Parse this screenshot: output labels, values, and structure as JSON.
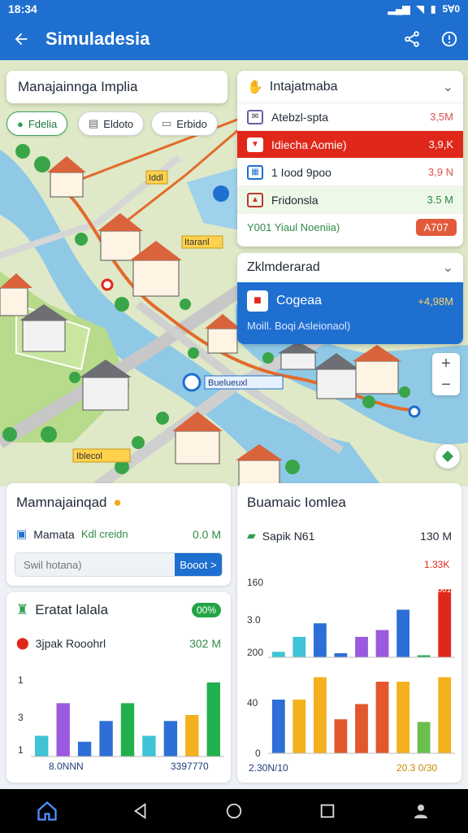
{
  "status": {
    "time": "18:34",
    "right_text": "5Ɐ0"
  },
  "appbar": {
    "title": "Simuladesia"
  },
  "search": {
    "text": "Manajainnga Implia"
  },
  "chips": [
    {
      "label": "Fdelia",
      "icon": "leaf-icon"
    },
    {
      "label": "Eldoto",
      "icon": "doc-icon"
    },
    {
      "label": "Erbido",
      "icon": "card-icon"
    }
  ],
  "panel": {
    "title": "Intajatmaba",
    "rows": [
      {
        "label": "Atebzl-spta",
        "value": "3,5M"
      },
      {
        "label": "Idiecha Aomie)",
        "value": "3,9,K"
      },
      {
        "label": "1 Iood 9poo",
        "value": "3,9 N"
      },
      {
        "label": "Fridonsla",
        "value": "3.5 M"
      }
    ],
    "footer": "Y001 Yiaul Noeniia)",
    "badge": "A707"
  },
  "panel2": {
    "title": "Zklmderarad",
    "item": "Cogeaa",
    "amount": "+4,98M",
    "sub": "Moill. Boqi Asleionaol)"
  },
  "map": {
    "labels": [
      "Iddl",
      "Itaranl",
      "Iblecol",
      "Buelueuxl"
    ]
  },
  "card1": {
    "title": "Mamnajainqad",
    "row_label": "Mamata",
    "row_sub": "Kdl creidn",
    "row_value": "0.0 M",
    "input_placeholder": "Swil hotana)",
    "button": "Booot >"
  },
  "card2": {
    "title": "Eratat lalala",
    "badge": "00%",
    "row_label": "3jpak Rooohrl",
    "row_value": "302 M",
    "yticks": [
      "1",
      "3",
      "1"
    ],
    "x_left": "8.0NNN",
    "x_right": "3397770"
  },
  "card3": {
    "title": "Buamaic Iomlea",
    "row_label": "Sapik N61",
    "row_value": "130 M",
    "top_value": "1.33K",
    "top_bar_label": "1001",
    "yticks": [
      "160",
      "3.0",
      "200",
      "40",
      "0"
    ],
    "x_left": "2.30N/10",
    "x_right": "20.3 0/30"
  },
  "chart_data": [
    {
      "type": "bar",
      "title": "Eratat lalala",
      "categories": [
        "1",
        "2",
        "3",
        "4",
        "5",
        "6",
        "7",
        "8",
        "9"
      ],
      "values": [
        0.7,
        1.8,
        0.5,
        1.2,
        1.8,
        0.7,
        1.2,
        1.4,
        2.5
      ],
      "colors": [
        "#3fc3d6",
        "#9b59e0",
        "#2d6fd6",
        "#2d6fd6",
        "#22b04e",
        "#3fc3d6",
        "#2d6fd6",
        "#f4b11e",
        "#22b04e"
      ],
      "ylim": [
        0,
        2.8
      ]
    },
    {
      "type": "bar",
      "title": "Buamaic Iomlea (upper)",
      "categories": [
        "1",
        "2",
        "3",
        "4",
        "5",
        "6",
        "7",
        "8",
        "9"
      ],
      "values": [
        8,
        30,
        50,
        6,
        30,
        40,
        70,
        3,
        100
      ],
      "colors": [
        "#3fc3d6",
        "#3fc3d6",
        "#2d6fd6",
        "#2d6fd6",
        "#9b59e0",
        "#9b59e0",
        "#2d6fd6",
        "#22b04e",
        "#e0281a"
      ],
      "ylim": [
        0,
        110
      ]
    },
    {
      "type": "bar",
      "title": "Buamaic Iomlea (lower)",
      "categories": [
        "1",
        "2",
        "3",
        "4",
        "5",
        "6",
        "7",
        "8",
        "9"
      ],
      "values": [
        60,
        60,
        85,
        38,
        55,
        80,
        80,
        35,
        85
      ],
      "colors": [
        "#2d6fd6",
        "#f4b11e",
        "#f4b11e",
        "#e2572d",
        "#e2572d",
        "#e2572d",
        "#f4b11e",
        "#6bbf4e",
        "#f4b11e"
      ],
      "ylim": [
        0,
        100
      ]
    }
  ]
}
